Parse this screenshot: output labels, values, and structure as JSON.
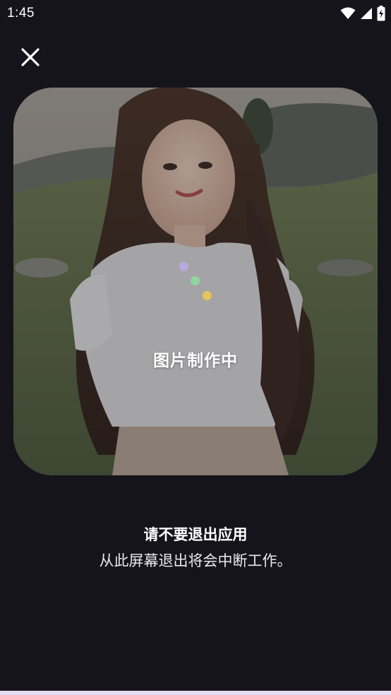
{
  "status_bar": {
    "time": "1:45",
    "icons": [
      "wifi-icon",
      "signal-icon",
      "battery-charging-icon"
    ]
  },
  "header": {
    "close_icon": "close-icon"
  },
  "card": {
    "image": "generated-portrait-image",
    "loader_colors": [
      "#b8a9e0",
      "#8fd6a0",
      "#e6c45a"
    ],
    "status_text": "图片制作中"
  },
  "notice": {
    "title": "请不要退出应用",
    "message": "从此屏幕退出将会中断工作。"
  },
  "colors": {
    "background": "#15141b",
    "bottom_bar": "#e3dcf5"
  }
}
